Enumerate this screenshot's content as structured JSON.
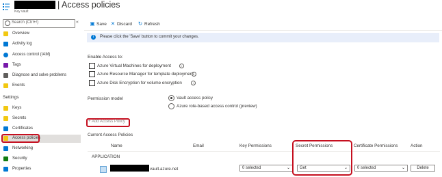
{
  "header": {
    "title": "| Access policies",
    "subtitle": "Key vault"
  },
  "sidebar": {
    "search_placeholder": "Search (Ctrl+/)",
    "collapse_glyph": "«",
    "items": [
      {
        "label": "Overview",
        "icon": "overview-icon",
        "color": "#f2c811"
      },
      {
        "label": "Activity log",
        "icon": "activity-log-icon",
        "color": "#0078d4"
      },
      {
        "label": "Access control (IAM)",
        "icon": "iam-icon",
        "color": "#0078d4"
      },
      {
        "label": "Tags",
        "icon": "tag-icon",
        "color": "#7719aa"
      },
      {
        "label": "Diagnose and solve problems",
        "icon": "wrench-icon",
        "color": "#605e5c"
      },
      {
        "label": "Events",
        "icon": "events-icon",
        "color": "#f2c811"
      }
    ],
    "settings_heading": "Settings",
    "settings_items": [
      {
        "label": "Keys",
        "icon": "key-icon",
        "color": "#f2c811"
      },
      {
        "label": "Secrets",
        "icon": "secret-icon",
        "color": "#f2c811"
      },
      {
        "label": "Certificates",
        "icon": "certificate-icon",
        "color": "#0078d4"
      },
      {
        "label": "Access policies",
        "icon": "access-policy-icon",
        "color": "#f2c811"
      },
      {
        "label": "Networking",
        "icon": "networking-icon",
        "color": "#0078d4"
      },
      {
        "label": "Security",
        "icon": "security-icon",
        "color": "#107c10"
      },
      {
        "label": "Properties",
        "icon": "properties-icon",
        "color": "#0078d4"
      }
    ]
  },
  "toolbar": {
    "save": "Save",
    "discard": "Discard",
    "refresh": "Refresh"
  },
  "info_bar": {
    "text": "Please click the 'Save' button to commit your changes."
  },
  "enable_access": {
    "label": "Enable Access to:",
    "options": [
      "Azure Virtual Machines for deployment",
      "Azure Resource Manager for template deployment",
      "Azure Disk Encryption for volume encryption"
    ]
  },
  "permission_model": {
    "label": "Permission model",
    "options": [
      "Vault access policy",
      "Azure role-based access control (preview)"
    ],
    "selected": 0
  },
  "add_policy": "+ Add Access Policy",
  "current_policies": "Current Access Policies",
  "table": {
    "columns": [
      "Name",
      "Email",
      "Key Permissions",
      "Secret Permissions",
      "Certificate Permissions",
      "Action"
    ],
    "group": "APPLICATION",
    "row": {
      "name_suffix": "vault.azure.net",
      "key_permissions": "0 selected",
      "secret_permissions": "Get",
      "certificate_permissions": "0 selected",
      "action": "Delete"
    }
  },
  "colors": {
    "accent": "#0078d4",
    "highlight": "#c50f1f",
    "info_bg": "#e8eefa"
  }
}
